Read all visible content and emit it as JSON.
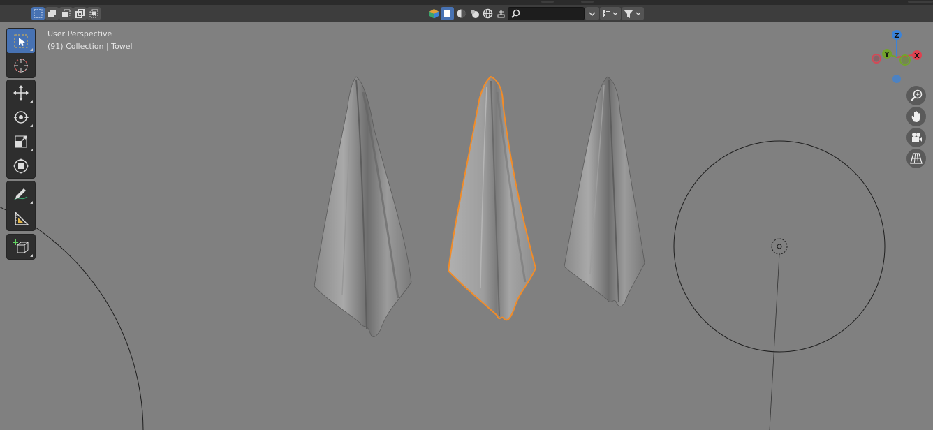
{
  "viewport": {
    "view_name": "User Perspective",
    "collection_info": "(91) Collection | Towel",
    "background": "#808080",
    "selection_outline_color": "#f28c28"
  },
  "header": {
    "select_modes": [
      {
        "icon": "select-new-icon",
        "active": true
      },
      {
        "icon": "select-extend-icon",
        "active": false
      },
      {
        "icon": "select-subtract-icon",
        "active": false
      },
      {
        "icon": "select-difference-icon",
        "active": false
      },
      {
        "icon": "select-intersect-icon",
        "active": false
      }
    ],
    "search": {
      "value": "",
      "placeholder": ""
    },
    "icons": [
      "scene-icon",
      "object-mode-icon",
      "shading-icon",
      "sphere-icon",
      "globe-icon",
      "sculpt-icon",
      "filter-icon",
      "display-mode-icon"
    ]
  },
  "toolbar": {
    "groups": [
      [
        "select-box-tool",
        "cursor-tool"
      ],
      [
        "move-tool",
        "rotate-tool",
        "scale-tool",
        "transform-tool"
      ],
      [
        "annotate-tool",
        "measure-tool"
      ],
      [
        "add-cube-tool"
      ]
    ],
    "active": "select-box-tool"
  },
  "gizmo": {
    "z_label": "Z",
    "y_label": "Y",
    "x_label": "X",
    "x_color": "#e0404f",
    "y_color": "#72a32b",
    "z_color": "#3b83d9"
  },
  "nav_buttons": [
    "zoom-icon",
    "pan-hand-icon",
    "camera-icon",
    "grid-icon"
  ]
}
